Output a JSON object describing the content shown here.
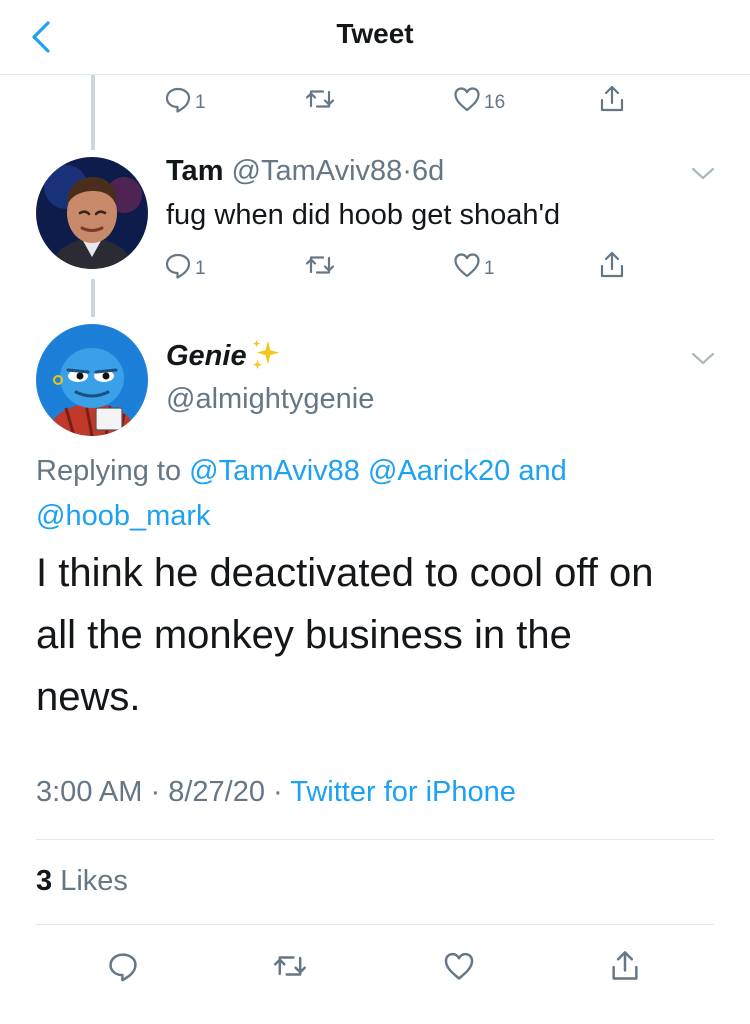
{
  "header": {
    "title": "Tweet"
  },
  "prev_tweet": {
    "reply_count": "1",
    "like_count": "16"
  },
  "reply_tweet": {
    "name": "Tam",
    "handle": "@TamAviv88",
    "separator": "·",
    "time": "6d",
    "text": "fug when did hoob get shoah'd",
    "reply_count": "1",
    "like_count": "1"
  },
  "main_tweet": {
    "name": "Genie",
    "handle": "@almightygenie",
    "replying_prefix": "Replying to",
    "replying_to": [
      "@TamAviv88",
      "@Aarick20"
    ],
    "replying_and": "and",
    "replying_last": "@hoob_mark",
    "text_lines": [
      "I think he deactivated to cool off on",
      "all the monkey business in the",
      "news."
    ],
    "time": "3:00 AM",
    "dot": "·",
    "date": "8/27/20",
    "source": "Twitter for iPhone",
    "likes_count": "3",
    "likes_label": "Likes"
  }
}
